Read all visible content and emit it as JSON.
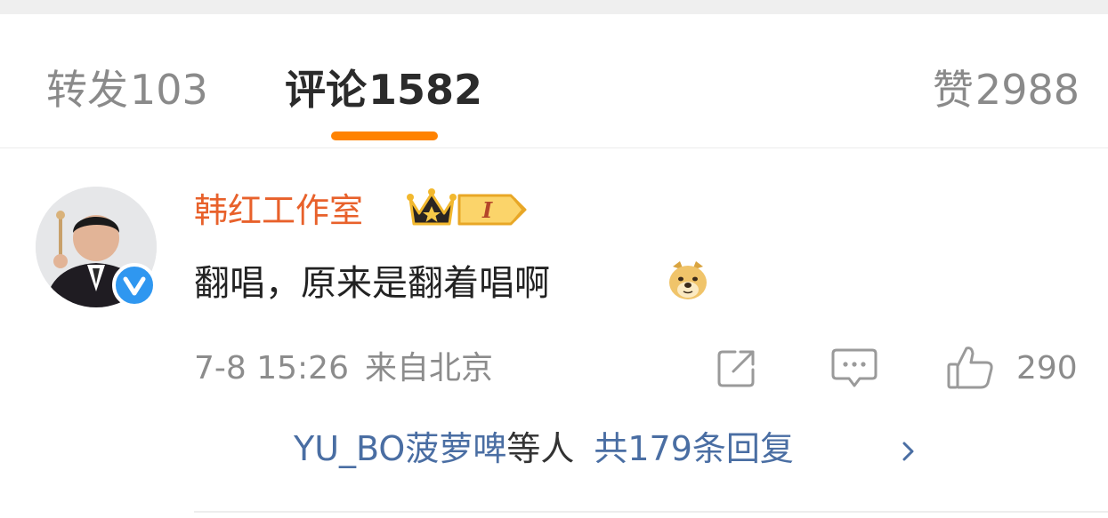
{
  "tabs": {
    "repost": {
      "label": "转发",
      "count": "103"
    },
    "comments": {
      "label": "评论",
      "count": "1582"
    },
    "likes": {
      "label": "赞",
      "count": "2988"
    }
  },
  "comment": {
    "username": "韩红工作室",
    "level_badge": "I",
    "text": "翻唱，原来是翻着唱啊",
    "emoji": "doge-icon",
    "date": "7-8 15:26",
    "location": "来自北京",
    "like_count": "290",
    "replies": {
      "first_replier": "YU_BO菠萝啤",
      "others_label": "等人",
      "total_label": "共179条回复"
    }
  },
  "colors": {
    "accent": "#ff8200",
    "username": "#e8612b",
    "link": "#4a6ea3",
    "verified": "#2f97f0",
    "muted": "#8c8c8c"
  }
}
